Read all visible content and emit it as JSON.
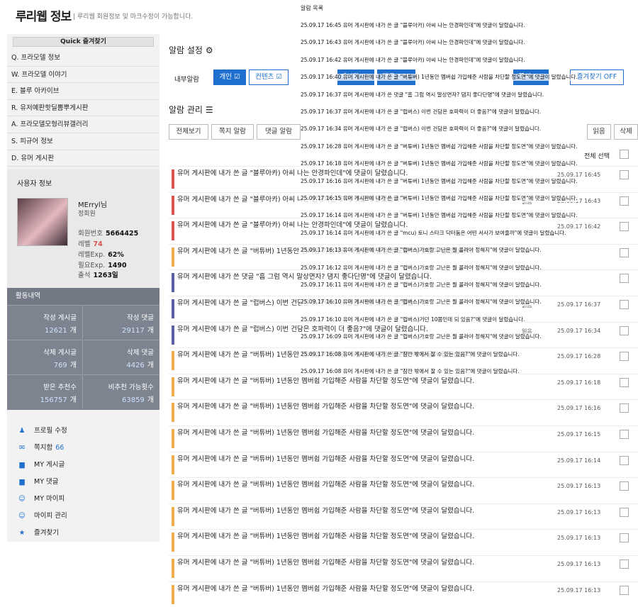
{
  "header": {
    "logo": "루리웹 정보",
    "tagline": "| 루리웹 회원정보 및 마크수정이 가능합니다."
  },
  "quick": {
    "title": "Quick 즐겨찾기",
    "items": [
      "Q. 프라모델 정보",
      "W. 프라모델 이야기",
      "E. 블루 아카이브",
      "R. 유저예판핫딜뽐뿌게시판",
      "A. 프라모델모형리뷰갤러리",
      "S. 피규어 정보",
      "D. 유머 게시판"
    ]
  },
  "user": {
    "title": "사용자 정보",
    "name": "MErryl님",
    "rank": "정회원",
    "stats": [
      {
        "k": "회원번호",
        "v": "5664425"
      },
      {
        "k": "레벨",
        "v": "74"
      },
      {
        "k": "레벨Exp.",
        "v": "62%"
      },
      {
        "k": "필요Exp.",
        "v": "1490"
      },
      {
        "k": "출석",
        "v": "1263일"
      }
    ]
  },
  "activity": {
    "title": "활동내역",
    "cells": [
      {
        "label": "작성 게시글",
        "value": "12621",
        "unit": "개"
      },
      {
        "label": "작성 댓글",
        "value": "29117",
        "unit": "개"
      },
      {
        "label": "삭제 게시글",
        "value": "769",
        "unit": "개"
      },
      {
        "label": "삭제 댓글",
        "value": "4426",
        "unit": "개"
      },
      {
        "label": "받은 추천수",
        "value": "156757",
        "unit": "개"
      },
      {
        "label": "비추천 가능횟수",
        "value": "63859",
        "unit": "개"
      }
    ]
  },
  "menu": [
    {
      "icon": "person-icon",
      "label": "프로필 수정"
    },
    {
      "icon": "mail-icon",
      "label": "쪽지함",
      "count": "66"
    },
    {
      "icon": "folder-icon",
      "label": "MY 게시글"
    },
    {
      "icon": "folder-icon",
      "label": "MY 댓글"
    },
    {
      "icon": "smile-icon",
      "label": "MY 마이피"
    },
    {
      "icon": "smile-icon",
      "label": "마이피 관리"
    },
    {
      "icon": "star-icon",
      "label": "즐겨찾기"
    }
  ],
  "settings": {
    "title": "알람 설정",
    "target_label": "내부알람",
    "personal": "개인",
    "content": "컨텐츠",
    "options": [
      "게시판 ON",
      "댓글 OFF",
      "쪽지 ON",
      "즐겨찾기 OFF"
    ]
  },
  "manage": {
    "title": "알람 관리",
    "filters": [
      "전체보기",
      "쪽지 알람",
      "댓글 알람"
    ],
    "read": "읽음",
    "delete": "삭제",
    "select_all": "전체 선택"
  },
  "rows": [
    {
      "color": "#d9534f",
      "text": "유머 게시판에 내가 쓴 글 \"블루아카) 아씨 나는 안경파인데\"에 댓글이 달렸습니다.",
      "date": "25.09.17 16:45"
    },
    {
      "color": "#d9534f",
      "text": "유머 게시판에 내가 쓴 글 \"블루아카) 아씨 나는 안경파인데\"에 댓글이 달렸습니다.",
      "date": "25.09.17 16:43",
      "read": "읽음"
    },
    {
      "color": "#d9534f",
      "text": "유머 게시판에 내가 쓴 글 \"블루아카) 아씨 나는 안경파인데\"에 댓글이 달렸습니다.",
      "date": "25.09.17 16:42"
    },
    {
      "color": "#f0ad4e",
      "text": "유머 게시판에 내가 쓴 글 \"버튜버) 1년동안 멤버쉽 가입해준 사람을 차단할 정도면\"에 댓글이 달렸습니다.",
      "date": ""
    },
    {
      "color": "#5b5fa6",
      "text": "유머 게시판에 내가 쓴 댓글 \"흠 그럼 역시 말상면자? 댐지 좋다단명\"에 댓글이 달렸습니다.",
      "date": ""
    },
    {
      "color": "#5b5fa6",
      "text": "유머 게시판에 내가 쓴 글 \"럽버스) 이번 건담은 호파력이 더 좋음?\"에 댓글이 달렸습니다.",
      "date": "25.09.17 16:37",
      "read": "읽음"
    },
    {
      "color": "#5b5fa6",
      "text": "유머 게시판에 내가 쓴 글 \"럽버스) 이번 건담은 호파력이 더 좋음?\"에 댓글이 달렸습니다.",
      "date": "25.09.17 16:34",
      "read": "읽음"
    },
    {
      "color": "#f0ad4e",
      "text": "유머 게시판에 내가 쓴 글 \"버튜버) 1년동안 멤버쉽 가입해준 사람을 차단할 정도면\"에 댓글이 달렸습니다.",
      "date": "25.09.17 16:28"
    },
    {
      "color": "#f0ad4e",
      "text": "유머 게시판에 내가 쓴 글 \"버튜버) 1년동안 멤버쉽 가입해준 사람을 차단할 정도면\"에 댓글이 달렸습니다.",
      "date": "25.09.17 16:18"
    },
    {
      "color": "#f0ad4e",
      "text": "유머 게시판에 내가 쓴 글 \"버튜버) 1년동안 멤버쉽 가입해준 사람을 차단할 정도면\"에 댓글이 달렸습니다.",
      "date": "25.09.17 16:16"
    },
    {
      "color": "#f0ad4e",
      "text": "유머 게시판에 내가 쓴 글 \"버튜버) 1년동안 멤버쉽 가입해준 사람을 차단할 정도면\"에 댓글이 달렸습니다.",
      "date": "25.09.17 16:15"
    },
    {
      "color": "#f0ad4e",
      "text": "유머 게시판에 내가 쓴 글 \"버튜버) 1년동안 멤버쉽 가입해준 사람을 차단할 정도면\"에 댓글이 달렸습니다.",
      "date": "25.09.17 16:14"
    },
    {
      "color": "#f0ad4e",
      "text": "유머 게시판에 내가 쓴 글 \"버튜버) 1년동안 멤버쉽 가입해준 사람을 차단할 정도면\"에 댓글이 달렸습니다.",
      "date": "25.09.17 16:13"
    },
    {
      "color": "#f0ad4e",
      "text": "유머 게시판에 내가 쓴 글 \"버튜버) 1년동안 멤버쉽 가입해준 사람을 차단할 정도면\"에 댓글이 달렸습니다.",
      "date": "25.09.17 16:13"
    },
    {
      "color": "#f0ad4e",
      "text": "유머 게시판에 내가 쓴 글 \"버튜버) 1년동안 멤버쉽 가입해준 사람을 차단할 정도면\"에 댓글이 달렸습니다.",
      "date": "25.09.17 16:13"
    },
    {
      "color": "#f0ad4e",
      "text": "유머 게시판에 내가 쓴 글 \"버튜버) 1년동안 멤버쉽 가입해준 사람을 차단할 정도면\"에 댓글이 달렸습니다.",
      "date": "25.09.17 16:13"
    },
    {
      "color": "#f0ad4e",
      "text": "유머 게시판에 내가 쓴 글 \"버튜버) 1년동안 멤버쉽 가입해준 사람을 차단할 정도면\"에 댓글이 달렸습니다.",
      "date": "25.09.17 16:13"
    }
  ],
  "alarm_list": {
    "title": "알람 목록",
    "items": [
      "25.09.17 16:45 유머 게시판에 내가 쓴 글 \"블루아카) 아씨 나는 안경파인데\"에 댓글이 달렸습니다.",
      "25.09.17 16:43 유머 게시판에 내가 쓴 글 \"블루아카) 아씨 나는 안경파인데\"에 댓글이 달렸습니다.",
      "25.09.17 16:42 유머 게시판에 내가 쓴 글 \"블루아카) 아씨 나는 안경파인데\"에 댓글이 달렸습니다.",
      "25.09.17 16:40 유머 게시판에 내가 쓴 글 \"버튜버) 1년동안 멤버쉽 가입해준 사람을 차단할 정도면\"에 댓글이 달렸습니다.",
      "25.09.17 16:37 유머 게시판에 내가 쓴 댓글 \"흠 그럼 역시 말상면자? 댐지 좋다단명\"에 댓글이 달렸습니다.",
      "25.09.17 16:37 유머 게시판에 내가 쓴 글 \"럽버스) 이번 건담은 호파력이 더 좋음?\"에 댓글이 달렸습니다.",
      "25.09.17 16:34 유머 게시판에 내가 쓴 글 \"럽버스) 이번 건담은 호파력이 더 좋음?\"에 댓글이 달렸습니다.",
      "25.09.17 16:28 유머 게시판에 내가 쓴 글 \"버튜버) 1년동안 멤버쉽 가입해준 사람을 차단할 정도면\"에 댓글이 달렸습니다.",
      "25.09.17 16:18 유머 게시판에 내가 쓴 글 \"버튜버) 1년동안 멤버쉽 가입해준 사람을 차단할 정도면\"에 댓글이 달렸습니다.",
      "25.09.17 16:16 유머 게시판에 내가 쓴 글 \"버튜버) 1년동안 멤버쉽 가입해준 사람을 차단할 정도면\"에 댓글이 달렸습니다.",
      "25.09.17 16:15 유머 게시판에 내가 쓴 글 \"버튜버) 1년동안 멤버쉽 가입해준 사람을 차단할 정도면\"에 댓글이 달렸습니다.",
      "25.09.17 16:14 유머 게시판에 내가 쓴 글 \"버튜버) 1년동안 멤버쉽 가입해준 사람을 차단할 정도면\"에 댓글이 달렸습니다.",
      "25.09.17 16:14 유머 게시판에 내가 쓴 글 \"mcu) 토니 스타크 닥터둠은 어떤 서사가 보여줄까\"에 댓글이 달렸습니다.",
      "25.09.17 16:13 유머 게시판에 내가 쓴 글 \"럽버스)가호랑 고난은 뭘 콜라야 정해지\"에 댓글이 달렸습니다.",
      "25.09.17 16:12 유머 게시판에 내가 쓴 글 \"럽버스)가호랑 고난은 뭘 콜라야 정해지\"에 댓글이 달렸습니다.",
      "25.09.17 16:11 유머 게시판에 내가 쓴 글 \"럽버스)가호랑 고난은 뭘 콜라야 정해지\"에 댓글이 달렸습니다.",
      "25.09.17 16:10 유머 게시판에 내가 쓴 글 \"럽버스)가호랑 고난은 뭘 콜라야 정해지\"에 댓글이 달렸습니다.",
      "25.09.17 16:10 유머 게시판에 내가 쓴 글 \"럽버스)거던 10쯤인데 되 있음?\"에 댓글이 달렸습니다.",
      "25.09.17 16:09 유머 게시판에 내가 쓴 글 \"럽버스)가호랑 고난은 뭘 콜라야 정해지\"에 댓글이 달렸습니다.",
      "25.09.17 16:08 유머 게시판에 내가 쓴 글 \"잠깐 밖에서 잘 수 있는 있음?\"에 댓글이 달렸습니다.",
      "25.09.17 16:08 유머 게시판에 내가 쓴 글 \"잠깐 밖에서 잘 수 있는 있음?\"에 댓글이 달렸습니다."
    ]
  }
}
